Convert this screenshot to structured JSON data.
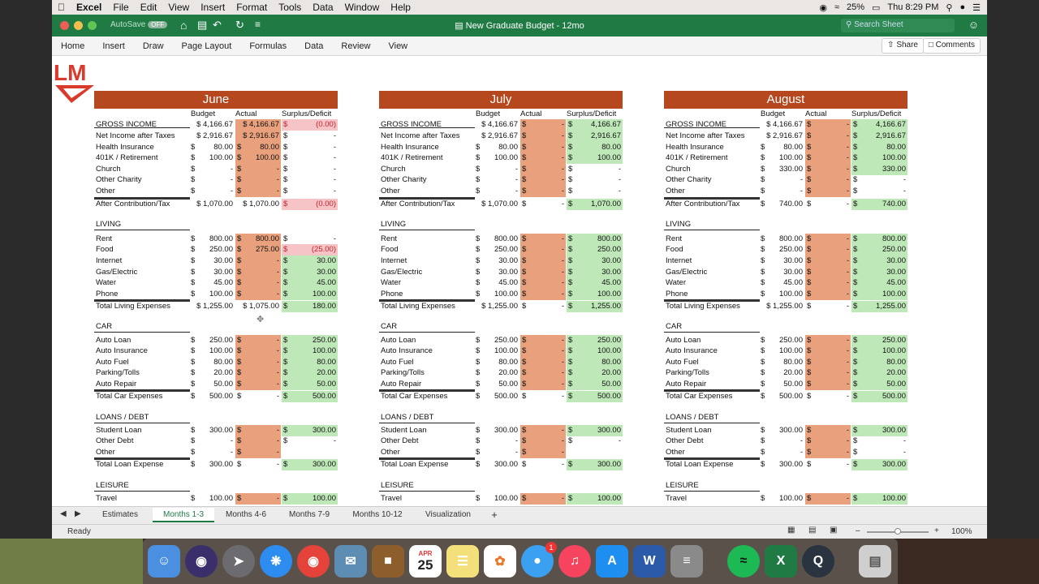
{
  "menubar": {
    "app": "Excel",
    "items": [
      "File",
      "Edit",
      "View",
      "Insert",
      "Format",
      "Tools",
      "Data",
      "Window",
      "Help"
    ],
    "battery": "25%",
    "clock": "Thu 8:29 PM"
  },
  "titlebar": {
    "doc": "New Graduate Budget - 12mo",
    "autosave": "AutoSave",
    "autosave_state": "OFF",
    "search_placeholder": "Search Sheet"
  },
  "ribbon": {
    "tabs": [
      "Home",
      "Insert",
      "Draw",
      "Page Layout",
      "Formulas",
      "Data",
      "Review",
      "View"
    ],
    "share": "Share",
    "comments": "Comments"
  },
  "logo": "LM",
  "col_headers": {
    "budget": "Budget",
    "actual": "Actual",
    "surplus": "Surplus/Deficit"
  },
  "sections": {
    "income": "GROSS INCOME",
    "living": "LIVING",
    "car": "CAR",
    "loans": "LOANS / DEBT",
    "leisure": "LEISURE"
  },
  "months": [
    {
      "name": "June",
      "income": [
        [
          "GROSS INCOME",
          "$ 4,166.67",
          "$ 4,166.67",
          "(0.00)"
        ],
        [
          "Net Income after Taxes",
          "$ 2,916.67",
          "$ 2,916.67",
          "-"
        ],
        [
          "Health Insurance",
          "80.00",
          "80.00",
          "-"
        ],
        [
          "401K / Retirement",
          "100.00",
          "100.00",
          "-"
        ],
        [
          "Church",
          "-",
          "-",
          "-"
        ],
        [
          "Other Charity",
          "-",
          "-",
          "-"
        ],
        [
          "Other",
          "-",
          "-",
          "-"
        ]
      ],
      "after": [
        "After Contribution/Tax",
        "$ 1,070.00",
        "$ 1,070.00",
        "(0.00)"
      ],
      "living": [
        [
          "Rent",
          "800.00",
          "800.00",
          "-"
        ],
        [
          "Food",
          "250.00",
          "275.00",
          "(25.00)"
        ],
        [
          "Internet",
          "30.00",
          "-",
          "30.00"
        ],
        [
          "Gas/Electric",
          "30.00",
          "-",
          "30.00"
        ],
        [
          "Water",
          "45.00",
          "-",
          "45.00"
        ],
        [
          "Phone",
          "100.00",
          "-",
          "100.00"
        ]
      ],
      "living_total": [
        "Total Living Expenses",
        "$ 1,255.00",
        "$ 1,075.00",
        "180.00"
      ],
      "car": [
        [
          "Auto Loan",
          "250.00",
          "-",
          "250.00"
        ],
        [
          "Auto Insurance",
          "100.00",
          "-",
          "100.00"
        ],
        [
          "Auto Fuel",
          "80.00",
          "-",
          "80.00"
        ],
        [
          "Parking/Tolls",
          "20.00",
          "-",
          "20.00"
        ],
        [
          "Auto Repair",
          "50.00",
          "-",
          "50.00"
        ]
      ],
      "car_total": [
        "Total Car Expenses",
        "500.00",
        "-",
        "500.00"
      ],
      "loans": [
        [
          "Student Loan",
          "300.00",
          "-",
          "300.00"
        ],
        [
          "Other Debt",
          "-",
          "-",
          "-"
        ],
        [
          "Other",
          "-",
          "-",
          ""
        ]
      ],
      "loans_total": [
        "Total Loan Expense",
        "300.00",
        "-",
        "300.00"
      ],
      "leisure": [
        [
          "Travel",
          "100.00",
          "-",
          "100.00"
        ]
      ]
    },
    {
      "name": "July",
      "income": [
        [
          "GROSS INCOME",
          "$ 4,166.67",
          "-",
          "4,166.67"
        ],
        [
          "Net Income after Taxes",
          "$ 2,916.67",
          "-",
          "2,916.67"
        ],
        [
          "Health Insurance",
          "80.00",
          "-",
          "80.00"
        ],
        [
          "401K / Retirement",
          "100.00",
          "-",
          "100.00"
        ],
        [
          "Church",
          "-",
          "-",
          "-"
        ],
        [
          "Other Charity",
          "-",
          "-",
          "-"
        ],
        [
          "Other",
          "-",
          "-",
          "-"
        ]
      ],
      "after": [
        "After Contribution/Tax",
        "$ 1,070.00",
        "-",
        "1,070.00"
      ],
      "living": [
        [
          "Rent",
          "800.00",
          "-",
          "800.00"
        ],
        [
          "Food",
          "250.00",
          "-",
          "250.00"
        ],
        [
          "Internet",
          "30.00",
          "-",
          "30.00"
        ],
        [
          "Gas/Electric",
          "30.00",
          "-",
          "30.00"
        ],
        [
          "Water",
          "45.00",
          "-",
          "45.00"
        ],
        [
          "Phone",
          "100.00",
          "-",
          "100.00"
        ]
      ],
      "living_total": [
        "Total Living Expenses",
        "$ 1,255.00",
        "-",
        "1,255.00"
      ],
      "car": [
        [
          "Auto Loan",
          "250.00",
          "-",
          "250.00"
        ],
        [
          "Auto Insurance",
          "100.00",
          "-",
          "100.00"
        ],
        [
          "Auto Fuel",
          "80.00",
          "-",
          "80.00"
        ],
        [
          "Parking/Tolls",
          "20.00",
          "-",
          "20.00"
        ],
        [
          "Auto Repair",
          "50.00",
          "-",
          "50.00"
        ]
      ],
      "car_total": [
        "Total Car Expenses",
        "500.00",
        "-",
        "500.00"
      ],
      "loans": [
        [
          "Student Loan",
          "300.00",
          "-",
          "300.00"
        ],
        [
          "Other Debt",
          "-",
          "-",
          "-"
        ],
        [
          "Other",
          "-",
          "-",
          ""
        ]
      ],
      "loans_total": [
        "Total Loan Expense",
        "300.00",
        "-",
        "300.00"
      ],
      "leisure": [
        [
          "Travel",
          "100.00",
          "-",
          "100.00"
        ]
      ]
    },
    {
      "name": "August",
      "income": [
        [
          "GROSS INCOME",
          "$ 4,166.67",
          "-",
          "4,166.67"
        ],
        [
          "Net Income after Taxes",
          "$ 2,916.67",
          "-",
          "2,916.67"
        ],
        [
          "Health Insurance",
          "80.00",
          "-",
          "80.00"
        ],
        [
          "401K / Retirement",
          "100.00",
          "-",
          "100.00"
        ],
        [
          "Church",
          "330.00",
          "-",
          "330.00"
        ],
        [
          "Other Charity",
          "-",
          "-",
          "-"
        ],
        [
          "Other",
          "-",
          "-",
          "-"
        ]
      ],
      "after": [
        "After Contribution/Tax",
        "740.00",
        "-",
        "740.00"
      ],
      "living": [
        [
          "Rent",
          "800.00",
          "-",
          "800.00"
        ],
        [
          "Food",
          "250.00",
          "-",
          "250.00"
        ],
        [
          "Internet",
          "30.00",
          "-",
          "30.00"
        ],
        [
          "Gas/Electric",
          "30.00",
          "-",
          "30.00"
        ],
        [
          "Water",
          "45.00",
          "-",
          "45.00"
        ],
        [
          "Phone",
          "100.00",
          "-",
          "100.00"
        ]
      ],
      "living_total": [
        "Total Living Expenses",
        "$ 1,255.00",
        "-",
        "1,255.00"
      ],
      "car": [
        [
          "Auto Loan",
          "250.00",
          "-",
          "250.00"
        ],
        [
          "Auto Insurance",
          "100.00",
          "-",
          "100.00"
        ],
        [
          "Auto Fuel",
          "80.00",
          "-",
          "80.00"
        ],
        [
          "Parking/Tolls",
          "20.00",
          "-",
          "20.00"
        ],
        [
          "Auto Repair",
          "50.00",
          "-",
          "50.00"
        ]
      ],
      "car_total": [
        "Total Car Expenses",
        "500.00",
        "-",
        "500.00"
      ],
      "loans": [
        [
          "Student Loan",
          "300.00",
          "-",
          "300.00"
        ],
        [
          "Other Debt",
          "-",
          "-",
          "-"
        ],
        [
          "Other",
          "-",
          "-",
          "-"
        ]
      ],
      "loans_total": [
        "Total Loan Expense",
        "300.00",
        "-",
        "300.00"
      ],
      "leisure": [
        [
          "Travel",
          "100.00",
          "-",
          "100.00"
        ]
      ]
    }
  ],
  "sheet_tabs": [
    "Estimates",
    "Months 1-3",
    "Months 4-6",
    "Months 7-9",
    "Months 10-12",
    "Visualization"
  ],
  "active_tab": "Months 1-3",
  "status": {
    "ready": "Ready",
    "zoom": "100%"
  },
  "dock": {
    "calendar_month": "APR",
    "calendar_day": "25",
    "badge": "1"
  }
}
